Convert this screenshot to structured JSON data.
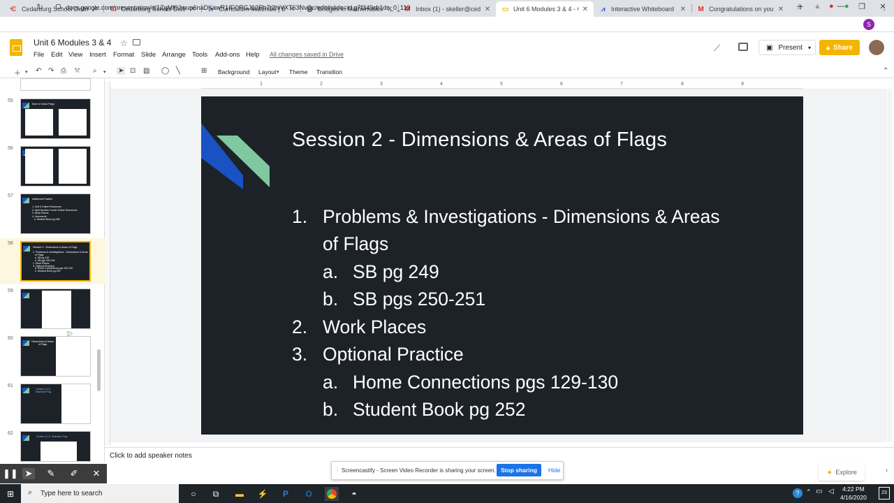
{
  "browser": {
    "tabs": [
      {
        "label": "Cedarburg School District"
      },
      {
        "label": "Cedarburg School District -"
      },
      {
        "label": "Curriculum Materials | Bridg"
      },
      {
        "label": "Bridges in Mathematics Gra"
      },
      {
        "label": "Inbox (1) - skeller@cedarbu"
      },
      {
        "label": "Unit 6 Modules 3 & 4 - Goo"
      },
      {
        "label": "Interactive Whiteboard by t"
      },
      {
        "label": "Congratulations on your Pa"
      }
    ],
    "new_tab": "+",
    "url": "docs.google.com/presentation/d/1ZqMf0Jmup6naDKawR1IFi0RGJ12Rh7t2hiVXT63NvOc/edit#slide=id.g7f349cb1dc_0_119"
  },
  "doc": {
    "title": "Unit 6 Modules 3 & 4",
    "menu": [
      "File",
      "Edit",
      "View",
      "Insert",
      "Format",
      "Slide",
      "Arrange",
      "Tools",
      "Add-ons",
      "Help"
    ],
    "saved_status": "All changes saved in Drive",
    "present_label": "Present",
    "share_label": "Share",
    "avatar_initial": "S"
  },
  "toolbar": {
    "background": "Background",
    "layout": "Layout",
    "theme": "Theme",
    "transition": "Transition"
  },
  "ruler": [
    "1",
    "2",
    "3",
    "4",
    "5",
    "6",
    "7",
    "8",
    "9"
  ],
  "filmstrip": [
    {
      "num": "55",
      "title": "More of Cedar Flags"
    },
    {
      "num": "56",
      "title": ""
    },
    {
      "num": "57",
      "title": "Additional Practice",
      "body": "1. Unit 6 Online Resources\n2. April Number Corner Online Resources\n3. Work Places\n4. Homework\n   a. Student Book pg 248"
    },
    {
      "num": "58",
      "title": "Session 2 - Dimensions & Areas of Flags",
      "body": "1. Problems & Investigations - Dimensions & Areas\n   of Flags\n   a. SB pg 249\n   b. SB pgs 250-251\n2. Work Places\n3. Optional Practice\n   a. Home Connections pgs 129-130\n   b. Student Book pg 252"
    },
    {
      "num": "59",
      "title": ""
    },
    {
      "num": "60",
      "title": "Dimensions & Areas of Flags"
    },
    {
      "num": "61",
      "title": "Create a U.S. Standard Flag"
    },
    {
      "num": "62",
      "title": "Create a U.S. Standard Flag"
    }
  ],
  "slide": {
    "title": "Session 2 - Dimensions & Areas of Flags",
    "items": [
      {
        "marker": "1.",
        "text": "Problems & Investigations - Dimensions & Areas"
      },
      {
        "marker": "",
        "text": "of Flags"
      },
      {
        "marker": "a.",
        "text": "SB pg 249"
      },
      {
        "marker": "b.",
        "text": "SB pgs 250-251"
      },
      {
        "marker": "2.",
        "text": "Work Places"
      },
      {
        "marker": "3.",
        "text": "Optional Practice"
      },
      {
        "marker": "a.",
        "text": "Home Connections pgs 129-130"
      },
      {
        "marker": "b.",
        "text": "Student Book pg 252"
      }
    ],
    "colors": {
      "background": "#1d2228",
      "accent_blue": "#1a52c4",
      "accent_green": "#81c79f"
    }
  },
  "notes_placeholder": "Click to add speaker notes",
  "screencastify": {
    "message": "Screencastify - Screen Video Recorder is sharing your screen.",
    "stop": "Stop sharing",
    "hide": "Hide"
  },
  "explore_label": "Explore",
  "taskbar": {
    "search_placeholder": "Type here to search",
    "time": "4:22 PM",
    "date": "4/16/2020",
    "notification_count": "23"
  }
}
